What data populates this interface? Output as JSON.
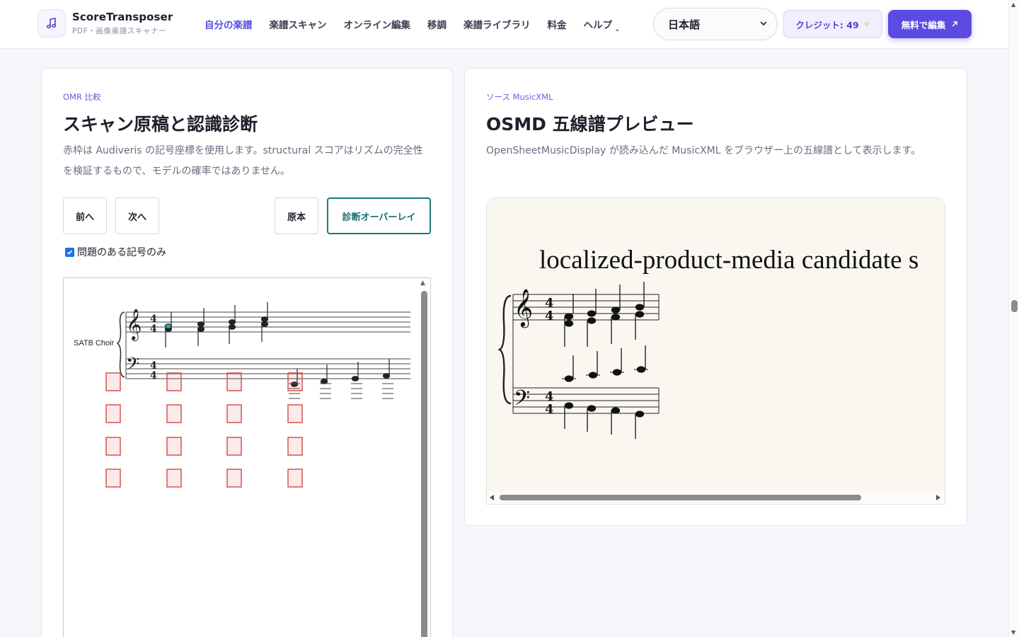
{
  "header": {
    "brand_name": "ScoreTransposer",
    "brand_sub": "PDF・画像楽譜スキャナー",
    "nav": [
      {
        "label": "自分の楽譜",
        "active": true
      },
      {
        "label": "楽譜スキャン"
      },
      {
        "label": "オンライン編集"
      },
      {
        "label": "移調"
      },
      {
        "label": "楽譜ライブラリ"
      },
      {
        "label": "料金"
      },
      {
        "label": "ヘルプ"
      }
    ],
    "language": "日本語",
    "credits_label": "クレジット: 49",
    "cta_label": "無料で編集"
  },
  "left_panel": {
    "eyebrow": "OMR 比較",
    "title": "スキャン原稿と認識診断",
    "description": "赤枠は Audiveris の記号座標を使用します。structural スコアはリズムの完全性を検証するもので、モデルの確率ではありません。",
    "prev_label": "前へ",
    "next_label": "次へ",
    "original_label": "原本",
    "overlay_label": "診断オーバーレイ",
    "checkbox_label": "問題のある記号のみ",
    "checkbox_checked": true,
    "part_label": "SATB Choir"
  },
  "right_panel": {
    "eyebrow": "ソース MusicXML",
    "title": "OSMD 五線譜プレビュー",
    "description": "OpenSheetMusicDisplay が読み込んだ MusicXML をブラウザー上の五線譜として表示します。",
    "score_title": "localized-product-media candidate s"
  },
  "colors": {
    "accent": "#5b4be3",
    "overlay_box": "#d9534f",
    "primary_button_border": "#177a7a"
  }
}
